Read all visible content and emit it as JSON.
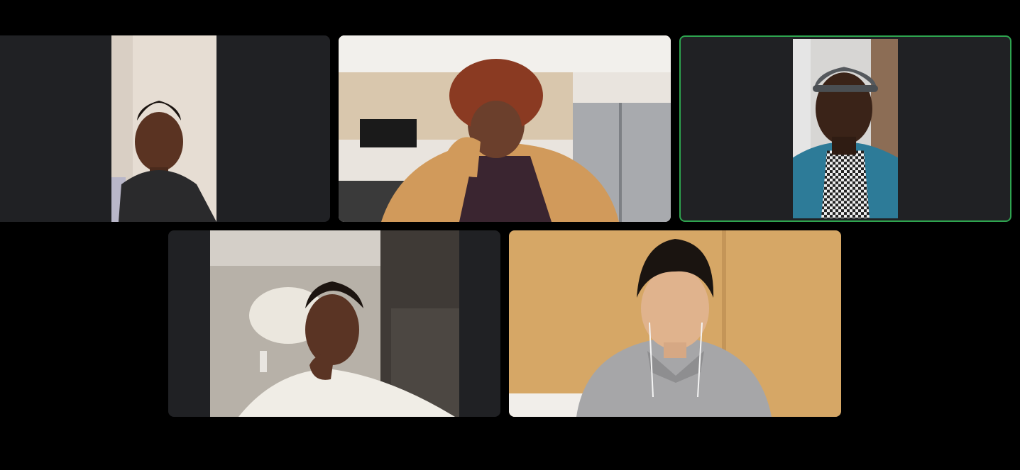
{
  "meeting": {
    "layout": "gallery-view",
    "participant_count": 5,
    "active_speaker_color": "#2ea44f",
    "tile_background": "#202124",
    "participants": [
      {
        "id": "p1",
        "active_speaker": false
      },
      {
        "id": "p2",
        "active_speaker": false
      },
      {
        "id": "p3",
        "active_speaker": true
      },
      {
        "id": "p4",
        "active_speaker": false
      },
      {
        "id": "p5",
        "active_speaker": false
      }
    ]
  }
}
